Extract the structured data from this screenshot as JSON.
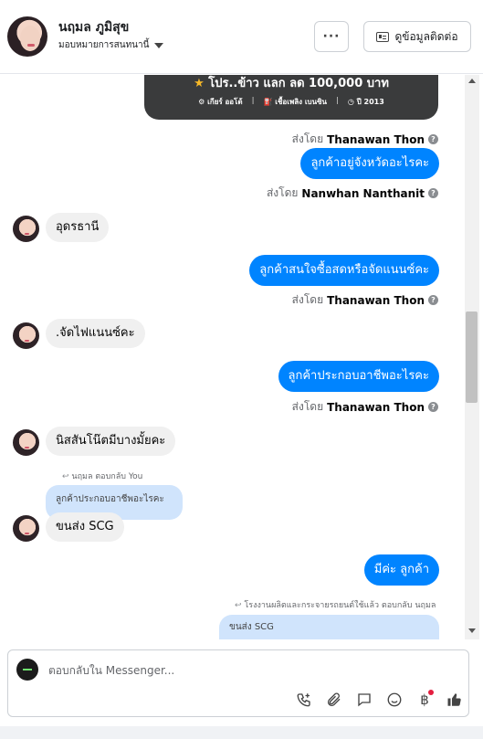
{
  "header": {
    "contact_name": "นฤมล ภูมิสุข",
    "assignee": "มอบหมายการสนทนานี้",
    "more_label": "···",
    "contact_info_label": "ดูข้อมูลติดต่อ"
  },
  "card": {
    "title_star": "★",
    "title": "โปร..ข้าว แลก ลด 100,000 บาท",
    "meta": [
      "⚙ เกียร์ ออโต้",
      "|",
      "⛽ เชื้อเพลิง เบนซิน",
      "|",
      "◷ ปี 2013"
    ]
  },
  "messages": {
    "sent_by_prefix": "ส่งโดย",
    "m1_sender": "Thanawan Thon",
    "m1_text": "ลูกค้าอยู่จังหวัดอะไรคะ",
    "m1_sentby": "Nanwhan Nanthanit",
    "m2_text": "อุดรธานี",
    "m3_text": "ลูกค้าสนใจซื้อสดหรือจัดแนนซ์คะ",
    "m3_sentby": "Thanawan Thon",
    "m4_text": ".จัดไฟแนนซ์คะ",
    "m5_text": "ลูกค้าประกอบอาชีพอะไรคะ",
    "m5_sentby": "Thanawan Thon",
    "m6_text": "นิสสันโน๊ตมีบางมั้ยคะ",
    "reply1_label": "นฤมล ตอบกลับ You",
    "reply1_quote": "ลูกค้าประกอบอาชีพอะไรคะ",
    "m7_text": "ขนส่ง SCG",
    "m8_text": "มีค่ะ ลูกค้า",
    "reply2_label": "โรงงานผลิตและกระจายรถยนต์ใช้แล้ว ตอบกลับ นฤมล",
    "reply2_quote": "ขนส่ง SCG"
  },
  "composer": {
    "placeholder": "ตอบกลับใน Messenger..."
  },
  "icons": [
    "question-icon",
    "reply-arrow-icon",
    "call-add-icon",
    "attach-icon",
    "saved-reply-icon",
    "emoji-icon",
    "currency-icon",
    "thumbs-up-icon"
  ],
  "colors": {
    "accent": "#0084ff",
    "incoming_bubble": "#f0f0f0",
    "quote_bubble": "#d0e4fc",
    "notification_dot": "#e41e3f"
  }
}
